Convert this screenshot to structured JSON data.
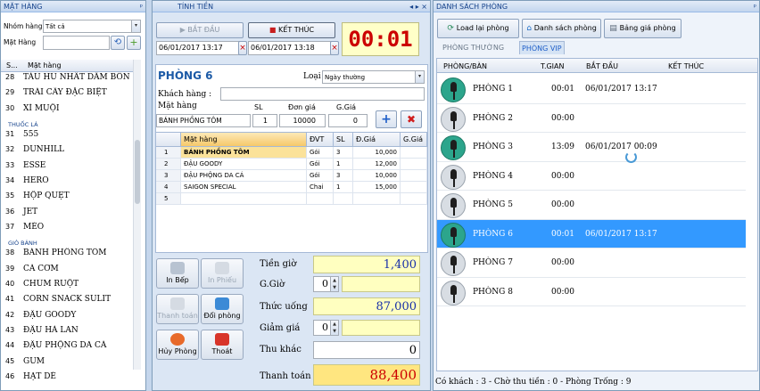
{
  "left": {
    "title": "MẶT HÀNG",
    "pin": "ᵖ",
    "nhom_label": "Nhóm hàng",
    "nhom_value": "Tất cả",
    "mathang_label": "Mặt Hàng",
    "mathang_value": "",
    "col_s": "S...",
    "col_name": "Mặt hàng",
    "rows": [
      {
        "n": "28",
        "name": "TÀU HŨ NHẤT DẦM BÔN"
      },
      {
        "n": "29",
        "name": "TRÁI CÂY ĐẶC BIỆT"
      },
      {
        "n": "30",
        "name": "XÍ MUỘI"
      },
      {
        "group": "THUỐC LÁ"
      },
      {
        "n": "31",
        "name": "555"
      },
      {
        "n": "32",
        "name": "DUNHILL"
      },
      {
        "n": "33",
        "name": "ESSE"
      },
      {
        "n": "34",
        "name": "HERO"
      },
      {
        "n": "35",
        "name": "HỘP QUẸT"
      },
      {
        "n": "36",
        "name": "JET"
      },
      {
        "n": "37",
        "name": "MÈO"
      },
      {
        "group": "GIÒ BÁNH"
      },
      {
        "n": "38",
        "name": "BÁNH PHỒNG TÔM"
      },
      {
        "n": "39",
        "name": "CÁ CƠM"
      },
      {
        "n": "40",
        "name": "CHÙM RUỘT"
      },
      {
        "n": "41",
        "name": "CORN SNACK SULIT"
      },
      {
        "n": "42",
        "name": "ĐẬU GOODY"
      },
      {
        "n": "43",
        "name": "ĐẬU HÀ LAN"
      },
      {
        "n": "44",
        "name": "ĐẬU PHỘNG DA CÁ"
      },
      {
        "n": "45",
        "name": "GUM"
      },
      {
        "n": "46",
        "name": "HẠT DẺ"
      }
    ]
  },
  "mid": {
    "title": "TÍNH TIỀN",
    "controls": "◂ ▸ ×",
    "start_label": "BẮT ĐẦU",
    "end_label": "KẾT THÚC",
    "start_time": "06/01/2017 13:17",
    "end_time": "06/01/2017 13:18",
    "timer": "00:01",
    "room": "PHÒNG 6",
    "loai_label": "Loại",
    "loai_value": "Ngày thường",
    "khach_label": "Khách hàng :",
    "khach_value": "",
    "mh_label": "Mặt hàng",
    "sl_label": "SL",
    "dg_label": "Đơn giá",
    "gg_label": "G.Giá",
    "mh_value": "BÁNH PHỒNG TÔM",
    "sl_value": "1",
    "dg_value": "10000",
    "gg_value": "0",
    "grid_cols": [
      "Mặt hàng",
      "ĐVT",
      "SL",
      "Đ.Giá",
      "G.Giá"
    ],
    "grid_rows": [
      {
        "idx": "1",
        "name": "BÁNH PHỒNG TÔM",
        "dvt": "Gói",
        "sl": "3",
        "dg": "10,000",
        "gg": ""
      },
      {
        "idx": "2",
        "name": "ĐẬU GOODY",
        "dvt": "Gói",
        "sl": "1",
        "dg": "12,000",
        "gg": ""
      },
      {
        "idx": "3",
        "name": "ĐẬU PHỘNG DA CÁ",
        "dvt": "Gói",
        "sl": "3",
        "dg": "10,000",
        "gg": ""
      },
      {
        "idx": "4",
        "name": "SAIGON SPECIAL",
        "dvt": "Chai",
        "sl": "1",
        "dg": "15,000",
        "gg": ""
      },
      {
        "idx": "5",
        "name": "",
        "dvt": "",
        "sl": "",
        "dg": "",
        "gg": ""
      }
    ],
    "btn_inbep": "In Bếp",
    "btn_inphieu": "In Phiếu",
    "btn_thanhtoan": "Thanh toán",
    "btn_doiphong": "Đổi phòng",
    "btn_huyphong": "Hủy Phòng",
    "btn_thoat": "Thoát",
    "tiengio_label": "Tiền giờ",
    "tiengio": "1,400",
    "ggio_label": "G.Giờ",
    "ggio": "0",
    "thucuong_label": "Thức uống",
    "thucuong": "87,000",
    "giamgia_label": "Giảm giá",
    "giamgia": "0",
    "thukhac_label": "Thu khác",
    "thukhac": "0",
    "thanhtoan_label": "Thanh toán",
    "thanhtoan": "88,400"
  },
  "right": {
    "title": "DANH SÁCH PHÒNG",
    "pin": "ᵖ",
    "btn_load": "Load lại phòng",
    "btn_ds": "Danh sách phòng",
    "btn_bg": "Bảng giá phòng",
    "tab1": "PHÒNG THƯỜNG",
    "tab2": "PHÒNG VIP",
    "cols": [
      "PHÒNG/BÀN",
      "T.GIAN",
      "BẮT ĐẦU",
      "KẾT THÚC"
    ],
    "rooms": [
      {
        "name": "PHÒNG 1",
        "time": "00:01",
        "start": "06/01/2017 13:17",
        "on": true
      },
      {
        "name": "PHÒNG 2",
        "time": "00:00",
        "start": "",
        "on": false
      },
      {
        "name": "PHÒNG 3",
        "time": "13:09",
        "start": "06/01/2017 00:09",
        "on": true
      },
      {
        "name": "PHÒNG 4",
        "time": "00:00",
        "start": "",
        "on": false
      },
      {
        "name": "PHÒNG 5",
        "time": "00:00",
        "start": "",
        "on": false
      },
      {
        "name": "PHÒNG 6",
        "time": "00:01",
        "start": "06/01/2017 13:17",
        "on": true
      },
      {
        "name": "PHÒNG 7",
        "time": "00:00",
        "start": "",
        "on": false
      },
      {
        "name": "PHÒNG 8",
        "time": "00:00",
        "start": "",
        "on": false
      }
    ],
    "selected_room": 5,
    "status": "Có khách : 3  -  Chờ thu tiền : 0  -  Phòng Trống : 9"
  },
  "colors": {
    "accent": "#3399ff",
    "timer_red": "#cc0000",
    "room_on": "#2ca58c",
    "total_yellow": "#ffffc0"
  }
}
